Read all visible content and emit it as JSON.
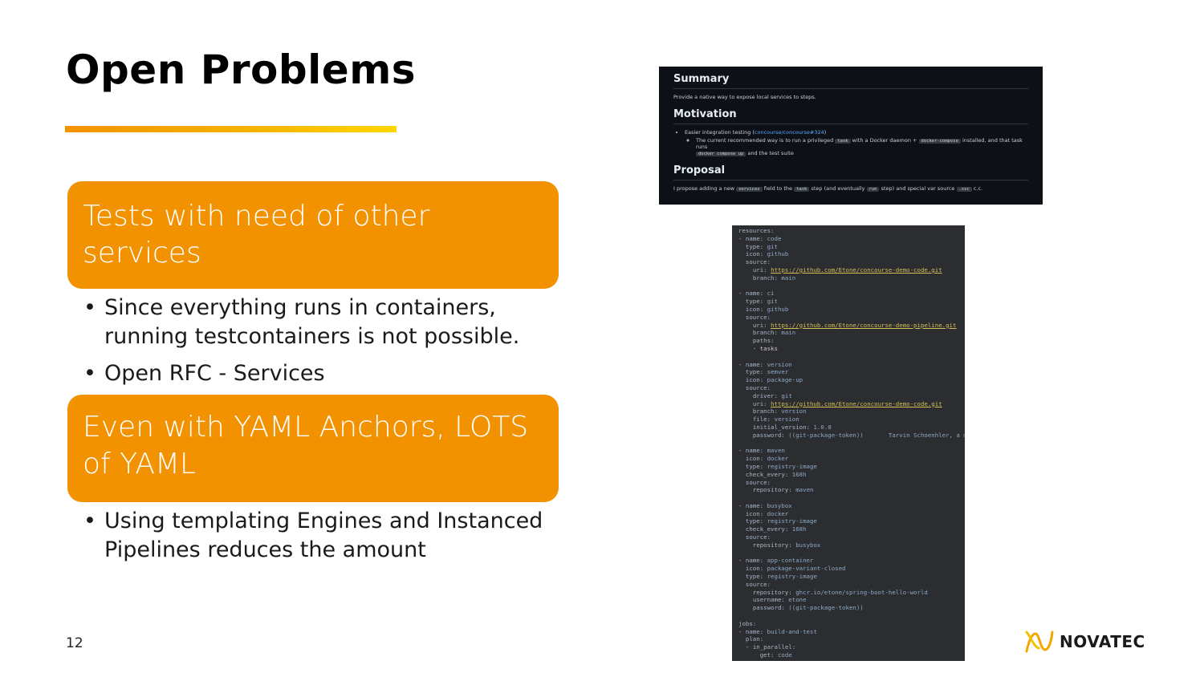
{
  "slide": {
    "title": "Open Problems",
    "page_number": "12",
    "accent_color": "#f39200"
  },
  "sections": [
    {
      "heading": "Tests with need of other services",
      "bullets": [
        "Since everything runs in containers, running testcontainers is not possible.",
        "Open RFC - Services"
      ]
    },
    {
      "heading": "Even with YAML Anchors, LOTS of YAML",
      "bullets": [
        "Using templating Engines and Instanced Pipelines reduces the amount"
      ]
    }
  ],
  "github_issue": {
    "summary_heading": "Summary",
    "summary_text": "Provide a native way to expose local services to steps.",
    "motivation_heading": "Motivation",
    "motivation_item_prefix": "Easier integration testing (",
    "motivation_item_link": "concourse/concourse#324",
    "motivation_item_suffix": ")",
    "motivation_sub_1": "The current recommended way is to run a privileged",
    "motivation_code_1": "task",
    "motivation_sub_2": "with a Docker daemon +",
    "motivation_code_2": "docker-compose",
    "motivation_sub_3": "installed, and that task runs",
    "motivation_code_3": "docker compose up",
    "motivation_sub_4": "and the test suite",
    "proposal_heading": "Proposal",
    "proposal_text_1": "I propose adding a new",
    "proposal_code_1": "services",
    "proposal_text_2": "field to the",
    "proposal_code_2": "task",
    "proposal_text_3": "step (and eventually",
    "proposal_code_3": "run",
    "proposal_text_4": "step) and special var source",
    "proposal_code_4": ".svc",
    "proposal_text_5": "c.c."
  },
  "yaml_lines": [
    "resources:",
    "- name: code",
    "  type: git",
    "  icon: github",
    "  source:",
    "    uri: https://github.com/Etone/concourse-demo-code.git",
    "    branch: main",
    "",
    "- name: ci",
    "  type: git",
    "  icon: github",
    "  source:",
    "    uri: https://github.com/Etone/concourse-demo-pipeline.git",
    "    branch: main",
    "    paths:",
    "    - tasks",
    "",
    "- name: version",
    "  type: semver",
    "  icon: package-up",
    "  source:",
    "    driver: git",
    "    uri: https://github.com/Etone/concourse-demo-code.git",
    "    branch: version",
    "    file: version",
    "    initial_version: 1.0.0",
    "    password: ((git-package-token))       Tarvin Schoenhler, a mon",
    "",
    "- name: maven",
    "  icon: docker",
    "  type: registry-image",
    "  check_every: 168h",
    "  source:",
    "    repository: maven",
    "",
    "- name: busybox",
    "  icon: docker",
    "  type: registry-image",
    "  check_every: 168h",
    "  source:",
    "    repository: busybox",
    "",
    "- name: app-container",
    "  icon: package-variant-closed",
    "  type: registry-image",
    "  source:",
    "    repository: ghcr.io/etone/spring-boot-hello-world",
    "    username: etone",
    "    password: ((git-package-token))",
    "",
    "jobs:",
    "- name: build-and-test",
    "  plan:",
    "  - in_parallel:",
    "      get: code"
  ],
  "logo": {
    "text": "NOVATEC",
    "icon": "novatec-logo-icon"
  }
}
